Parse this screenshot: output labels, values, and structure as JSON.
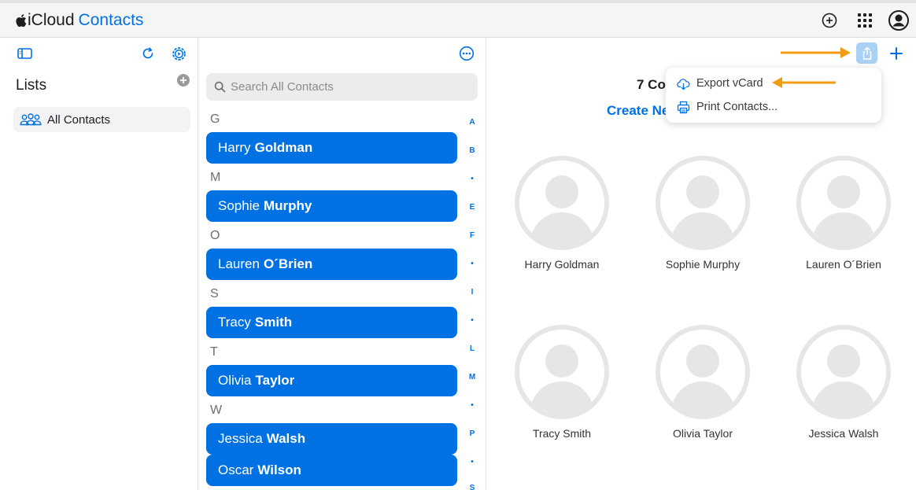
{
  "app": {
    "brand_name": "iCloud",
    "app_name": "Contacts"
  },
  "topbar": {
    "icons": [
      "add-circle-icon",
      "app-grid-icon",
      "account-icon"
    ]
  },
  "sidebar": {
    "lists_title": "Lists",
    "items": [
      {
        "label": "All Contacts",
        "icon": "people-icon"
      }
    ]
  },
  "contact_list": {
    "search_placeholder": "Search All Contacts",
    "sections": [
      {
        "letter": "G",
        "contacts": [
          {
            "first": "Harry",
            "last": "Goldman"
          }
        ]
      },
      {
        "letter": "M",
        "contacts": [
          {
            "first": "Sophie",
            "last": "Murphy"
          }
        ]
      },
      {
        "letter": "O",
        "contacts": [
          {
            "first": "Lauren",
            "last": "O´Brien"
          }
        ]
      },
      {
        "letter": "S",
        "contacts": [
          {
            "first": "Tracy",
            "last": "Smith"
          }
        ]
      },
      {
        "letter": "T",
        "contacts": [
          {
            "first": "Olivia",
            "last": "Taylor"
          }
        ]
      },
      {
        "letter": "W",
        "contacts": [
          {
            "first": "Jessica",
            "last": "Walsh"
          },
          {
            "first": "Oscar",
            "last": "Wilson"
          }
        ]
      }
    ],
    "index_letters": [
      "A",
      "B",
      "•",
      "E",
      "F",
      "•",
      "I",
      "•",
      "L",
      "M",
      "•",
      "P",
      "•",
      "S"
    ]
  },
  "main": {
    "count_text": "7 Co",
    "create_link": "Create Ne",
    "cards": [
      {
        "name": "Harry Goldman"
      },
      {
        "name": "Sophie Murphy"
      },
      {
        "name": "Lauren O´Brien"
      },
      {
        "name": "Tracy Smith"
      },
      {
        "name": "Olivia Taylor"
      },
      {
        "name": "Jessica Walsh"
      }
    ]
  },
  "share_menu": {
    "items": [
      {
        "label": "Export vCard",
        "icon": "cloud-download-icon"
      },
      {
        "label": "Print Contacts...",
        "icon": "printer-icon"
      }
    ]
  },
  "colors": {
    "accent": "#0071e3",
    "annotation_arrow": "#f39c12",
    "avatar": "#e6e6e6"
  }
}
